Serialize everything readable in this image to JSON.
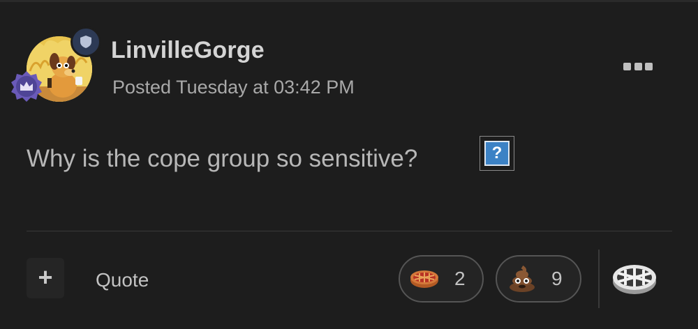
{
  "post": {
    "username": "LinvilleGorge",
    "posted": "Posted Tuesday at 03:42 PM",
    "content": "Why is the cope group so sensitive?",
    "inline_icon": "?"
  },
  "actions": {
    "quote_label": "Quote",
    "reactions": [
      {
        "icon": "pie-icon",
        "count": "2"
      },
      {
        "icon": "poop-icon",
        "count": "9"
      }
    ]
  },
  "icons": {
    "avatar": "this-is-fine-dog-avatar",
    "status_badge": "shield-icon",
    "rank_badge": "crown-icon",
    "menu": "more-options-icon",
    "add": "plus-icon",
    "react": "pie-react-icon"
  },
  "colors": {
    "background": "#1d1d1d",
    "badge_blue": "#2d3a55",
    "rank_purple": "#6a5ab8",
    "question_blue": "#3c82c5"
  }
}
